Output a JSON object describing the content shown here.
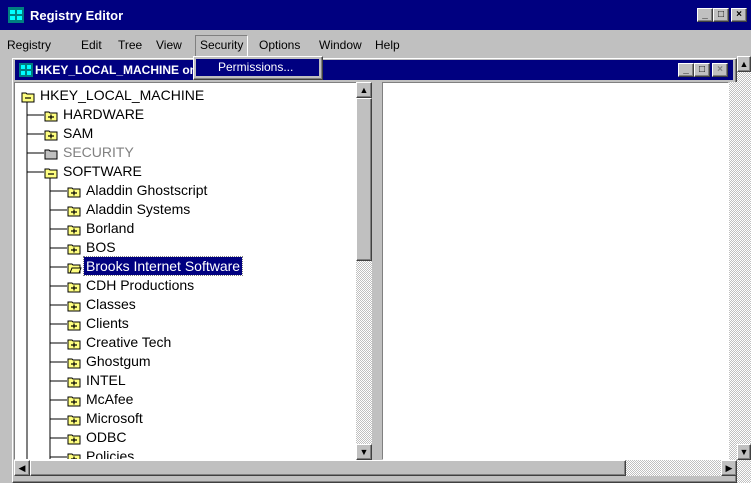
{
  "window": {
    "title": "Registry Editor",
    "min_glyph": "_",
    "max_glyph": "□",
    "close_glyph": "×"
  },
  "menubar": {
    "items": [
      "Registry",
      "Edit",
      "Tree",
      "View",
      "Security",
      "Options",
      "Window",
      "Help"
    ]
  },
  "security_menu": {
    "items": [
      "Permissions..."
    ]
  },
  "child_window": {
    "title": "HKEY_LOCAL_MACHINE on Local Machine",
    "min_glyph": "_",
    "max_glyph": "□",
    "close_glyph": "×"
  },
  "tree": {
    "nodes": [
      {
        "label": "HKEY_LOCAL_MACHINE",
        "level": 0,
        "state": "open"
      },
      {
        "label": "HARDWARE",
        "level": 1,
        "state": "plus"
      },
      {
        "label": "SAM",
        "level": 1,
        "state": "plus"
      },
      {
        "label": "SECURITY",
        "level": 1,
        "state": "disabled"
      },
      {
        "label": "SOFTWARE",
        "level": 1,
        "state": "open"
      },
      {
        "label": "Aladdin Ghostscript",
        "level": 2,
        "state": "plus"
      },
      {
        "label": "Aladdin Systems",
        "level": 2,
        "state": "plus"
      },
      {
        "label": "Borland",
        "level": 2,
        "state": "plus"
      },
      {
        "label": "BOS",
        "level": 2,
        "state": "plus"
      },
      {
        "label": "Brooks Internet Software",
        "level": 2,
        "state": "selected"
      },
      {
        "label": "CDH Productions",
        "level": 2,
        "state": "plus"
      },
      {
        "label": "Classes",
        "level": 2,
        "state": "plus"
      },
      {
        "label": "Clients",
        "level": 2,
        "state": "plus"
      },
      {
        "label": "Creative Tech",
        "level": 2,
        "state": "plus"
      },
      {
        "label": "Ghostgum",
        "level": 2,
        "state": "plus"
      },
      {
        "label": "INTEL",
        "level": 2,
        "state": "plus"
      },
      {
        "label": "McAfee",
        "level": 2,
        "state": "plus"
      },
      {
        "label": "Microsoft",
        "level": 2,
        "state": "plus"
      },
      {
        "label": "ODBC",
        "level": 2,
        "state": "plus"
      },
      {
        "label": "Policies",
        "level": 2,
        "state": "plus"
      }
    ]
  },
  "tree_scrollbar": {
    "thumb_fraction": 0.47
  },
  "colors": {
    "titlebar": "#000080",
    "face": "#c0c0c0",
    "folder": "#ffff80",
    "selection": "#000080"
  }
}
